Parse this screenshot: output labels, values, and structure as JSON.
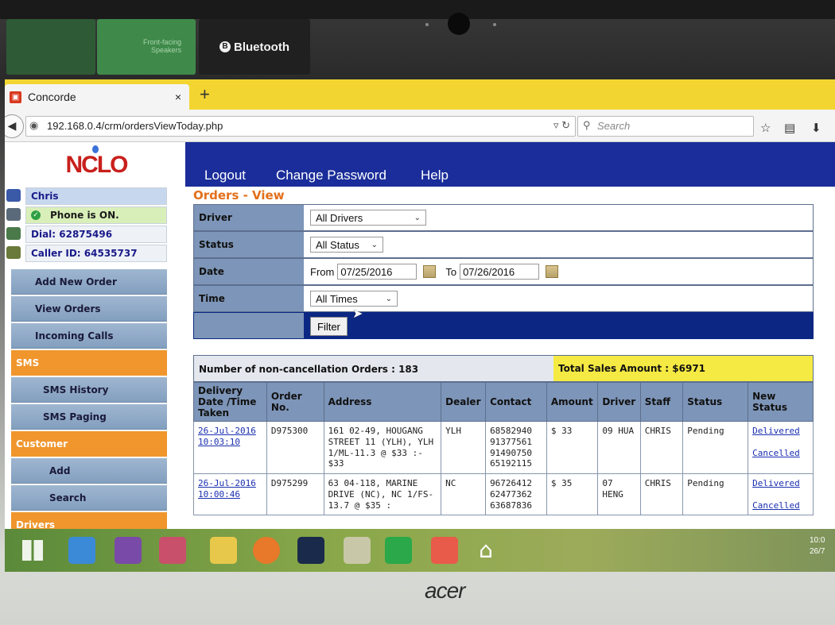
{
  "dock": {
    "btn2_line1": "Front-facing",
    "btn2_line2": "Speakers",
    "bluetooth": "Bluetooth"
  },
  "browser": {
    "tab_title": "Concorde",
    "tab_close": "×",
    "new_tab": "+",
    "url": "192.168.0.4/crm/ordersViewToday.php",
    "search_placeholder": "Search"
  },
  "nav": {
    "logout": "Logout",
    "change_password": "Change Password",
    "help": "Help"
  },
  "logo": {
    "text": "NCLO"
  },
  "user": {
    "name": "Chris",
    "phone_status": "Phone is ON.",
    "dial": "Dial: 62875496",
    "caller_id": "Caller ID: 64535737"
  },
  "menu": {
    "add_new_order": "Add New Order",
    "view_orders": "View Orders",
    "incoming_calls": "Incoming Calls",
    "sms": "SMS",
    "sms_history": "SMS History",
    "sms_paging": "SMS Paging",
    "customer": "Customer",
    "add": "Add",
    "search": "Search",
    "drivers": "Drivers"
  },
  "content": {
    "title": "Orders - View",
    "filters": {
      "driver_label": "Driver",
      "driver_value": "All Drivers",
      "status_label": "Status",
      "status_value": "All Status",
      "date_label": "Date",
      "from_label": "From",
      "from_value": "07/25/2016",
      "to_label": "To",
      "to_value": "07/26/2016",
      "time_label": "Time",
      "time_value": "All Times",
      "filter_button": "Filter"
    },
    "summary": {
      "count": "Number of non-cancellation Orders : 183",
      "total": "Total Sales Amount : $6971"
    }
  },
  "table": {
    "headers": {
      "delivery": "Delivery Date /Time Taken",
      "order_no": "Order No.",
      "address": "Address",
      "dealer": "Dealer",
      "contact": "Contact",
      "amount": "Amount",
      "driver": "Driver",
      "staff": "Staff",
      "status": "Status",
      "new_status": "New Status"
    },
    "rows": [
      {
        "date": "26-Jul-2016",
        "time": "10:03:10",
        "order": "D975300",
        "address": "161 02-49, HOUGANG STREET 11 (YLH), YLH 1/ML-11.3 @ $33 :- $33",
        "dealer": "YLH",
        "contact": "68582940 91377561 91490750 65192115",
        "amount": "$ 33",
        "driver": "09 HUA",
        "staff": "CHRIS",
        "status": "Pending",
        "delivered": "Delivered",
        "cancelled": "Cancelled"
      },
      {
        "date": "26-Jul-2016",
        "time": "10:00:46",
        "order": "D975299",
        "address": "63 04-118, MARINE DRIVE (NC), NC 1/FS-13.7 @ $35 :",
        "dealer": "NC",
        "contact": "96726412 62477362 63687836",
        "amount": "$ 35",
        "driver": "07 HENG",
        "staff": "CHRIS",
        "status": "Pending",
        "delivered": "Delivered",
        "cancelled": "Cancelled"
      }
    ]
  },
  "taskbar": {
    "clock": "10:0",
    "date": "26/7"
  },
  "brand": "acer",
  "colors": {
    "nav_blue": "#1a2d9a",
    "title_orange": "#e36f1a",
    "tab_yellow": "#f3d532",
    "total_yellow": "#f5ea43"
  }
}
